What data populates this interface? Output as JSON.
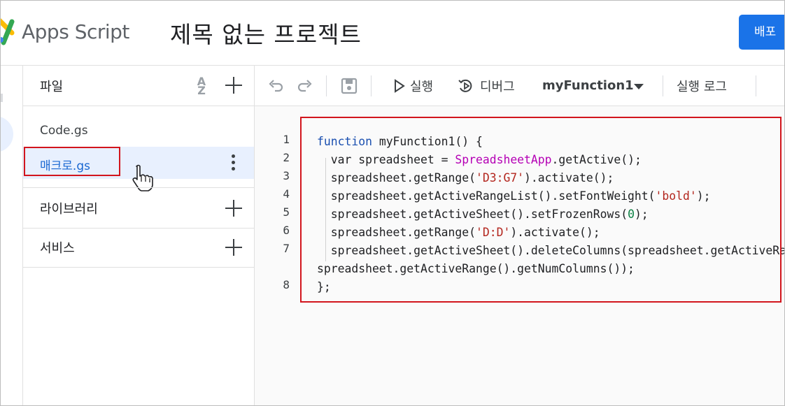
{
  "header": {
    "app_name": "Apps Script",
    "project_title": "제목 없는 프로젝트",
    "deploy_label": "배포"
  },
  "sidebar": {
    "files": {
      "title": "파일",
      "sort_icon_text": [
        "A",
        "Z"
      ],
      "items": [
        {
          "label": "Code.gs",
          "selected": false
        },
        {
          "label": "매크로.gs",
          "selected": true
        }
      ]
    },
    "libraries": {
      "title": "라이브러리"
    },
    "services": {
      "title": "서비스"
    }
  },
  "toolbar": {
    "run_label": "실행",
    "debug_label": "디버그",
    "function_select": "myFunction1",
    "execution_log_label": "실행 로그"
  },
  "editor": {
    "line_numbers": [
      "1",
      "2",
      "3",
      "4",
      "5",
      "6",
      "7",
      "8"
    ],
    "lines": [
      {
        "t": [
          [
            "kw",
            "function"
          ],
          [
            "p",
            " myFunction1() {"
          ]
        ]
      },
      {
        "t": [
          [
            "p",
            "  var spreadsheet = "
          ],
          [
            "cls",
            "SpreadsheetApp"
          ],
          [
            "p",
            ".getActive();"
          ]
        ]
      },
      {
        "t": [
          [
            "p",
            "  spreadsheet.getRange("
          ],
          [
            "str",
            "'D3:G7'"
          ],
          [
            "p",
            ").activate();"
          ]
        ]
      },
      {
        "t": [
          [
            "p",
            "  spreadsheet.getActiveRangeList().setFontWeight("
          ],
          [
            "str",
            "'bold'"
          ],
          [
            "p",
            ");"
          ]
        ]
      },
      {
        "t": [
          [
            "p",
            "  spreadsheet.getActiveSheet().setFrozenRows("
          ],
          [
            "num",
            "0"
          ],
          [
            "p",
            ");"
          ]
        ]
      },
      {
        "t": [
          [
            "p",
            "  spreadsheet.getRange("
          ],
          [
            "str",
            "'D:D'"
          ],
          [
            "p",
            ").activate();"
          ]
        ]
      },
      {
        "t": [
          [
            "p",
            "  spreadsheet.getActiveSheet().deleteColumns(spreadsheet.getActiveRange().getColumn(),"
          ]
        ]
      },
      {
        "t": [
          [
            "p",
            "spreadsheet.getActiveRange().getNumColumns());"
          ]
        ]
      },
      {
        "t": [
          [
            "p",
            "};"
          ]
        ]
      }
    ]
  },
  "colors": {
    "accent": "#1a73e8",
    "highlight_border": "#d2151d",
    "selected_bg": "#e8f0fe"
  }
}
